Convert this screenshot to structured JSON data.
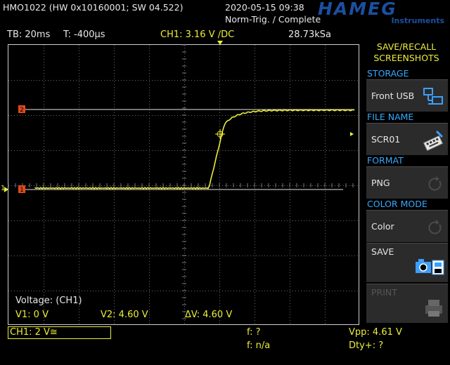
{
  "header": {
    "model": "HMO1022 (HW 0x10160001; SW 04.522)",
    "datetime": "2020-05-15 09:38",
    "trigger_status": "Norm-Trig. / Complete",
    "logo": "HAMEG",
    "logo_sub": "Instruments"
  },
  "status": {
    "timebase": "TB: 20ms",
    "trigger_pos": "T: -400µs",
    "channel_info": "CH1: 3.16 V ∕DC",
    "sample_rate": "28.73kSa"
  },
  "cursor": {
    "title": "Voltage: (CH1)",
    "v1": "V1: 0 V",
    "v2": "V2: 4.60 V",
    "dv": "ΔV: 4.60 V"
  },
  "bottom": {
    "ch1_setting": "CH1: 2 V≅",
    "freq1": "f: ?",
    "freq2": "f: n/a",
    "vpp": "Vpp: 4.61 V",
    "duty": "Dty+: ?"
  },
  "menu": {
    "title": "SAVE/RECALL SCREENSHOTS",
    "storage_label": "STORAGE",
    "storage_value": "Front USB",
    "file_name_label": "FILE NAME",
    "file_name_value": "SCR01",
    "format_label": "FORMAT",
    "format_value": "PNG",
    "color_mode_label": "COLOR MODE",
    "color_mode_value": "Color",
    "save_label": "SAVE",
    "print_label": "PRINT"
  },
  "markers": {
    "cursor1": "1",
    "cursor2": "2",
    "channel": "1"
  },
  "colors": {
    "trace": "#eded3a",
    "accent_blue": "#33aaff",
    "cursor_marker": "#e04a1a",
    "logo": "#1b4fa0"
  }
}
